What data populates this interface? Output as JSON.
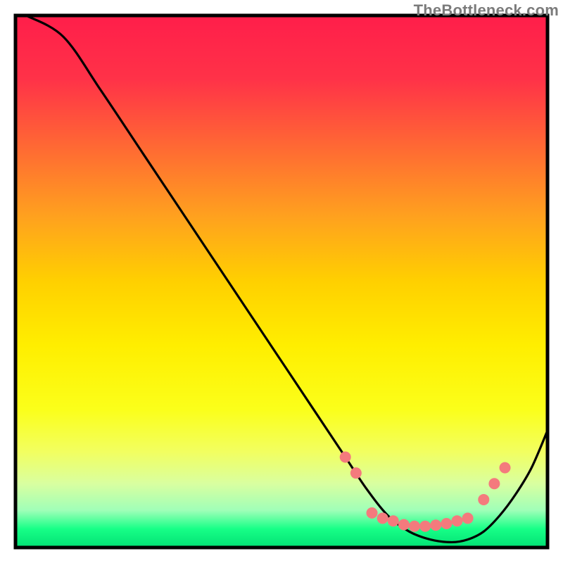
{
  "watermark": "TheBottleneck.com",
  "chart_data": {
    "type": "line",
    "title": "",
    "xlabel": "",
    "ylabel": "",
    "xlim": [
      0,
      100
    ],
    "ylim": [
      0,
      100
    ],
    "gradient_stops": [
      {
        "offset": 0.0,
        "color": "#ff1e4a"
      },
      {
        "offset": 0.12,
        "color": "#ff3248"
      },
      {
        "offset": 0.25,
        "color": "#ff6a33"
      },
      {
        "offset": 0.38,
        "color": "#ffa21e"
      },
      {
        "offset": 0.5,
        "color": "#ffd000"
      },
      {
        "offset": 0.62,
        "color": "#ffee00"
      },
      {
        "offset": 0.74,
        "color": "#fbff1a"
      },
      {
        "offset": 0.82,
        "color": "#f2ff60"
      },
      {
        "offset": 0.88,
        "color": "#d9ffa0"
      },
      {
        "offset": 0.93,
        "color": "#a0ffb8"
      },
      {
        "offset": 0.965,
        "color": "#17ff87"
      },
      {
        "offset": 1.0,
        "color": "#02e074"
      }
    ],
    "series": [
      {
        "name": "bottleneck-curve",
        "x": [
          2,
          9,
          16,
          24,
          32,
          40,
          48,
          56,
          62,
          66,
          70,
          74,
          78,
          82,
          85,
          88,
          91,
          94,
          97,
          100
        ],
        "y": [
          100,
          96,
          86,
          74,
          62,
          50,
          38,
          26,
          17,
          11,
          6,
          3,
          1.5,
          1,
          1.5,
          3,
          6,
          10,
          15,
          22
        ]
      }
    ],
    "markers": {
      "name": "highlight-dots",
      "color": "#f47a7d",
      "radius": 8,
      "points": [
        {
          "x": 62,
          "y": 17
        },
        {
          "x": 64,
          "y": 14
        },
        {
          "x": 67,
          "y": 6.5
        },
        {
          "x": 69,
          "y": 5.5
        },
        {
          "x": 71,
          "y": 5
        },
        {
          "x": 73,
          "y": 4.3
        },
        {
          "x": 75,
          "y": 4
        },
        {
          "x": 77,
          "y": 4
        },
        {
          "x": 79,
          "y": 4.2
        },
        {
          "x": 81,
          "y": 4.5
        },
        {
          "x": 83,
          "y": 5
        },
        {
          "x": 85,
          "y": 5.5
        },
        {
          "x": 88,
          "y": 9
        },
        {
          "x": 90,
          "y": 12
        },
        {
          "x": 92,
          "y": 15
        }
      ]
    }
  }
}
